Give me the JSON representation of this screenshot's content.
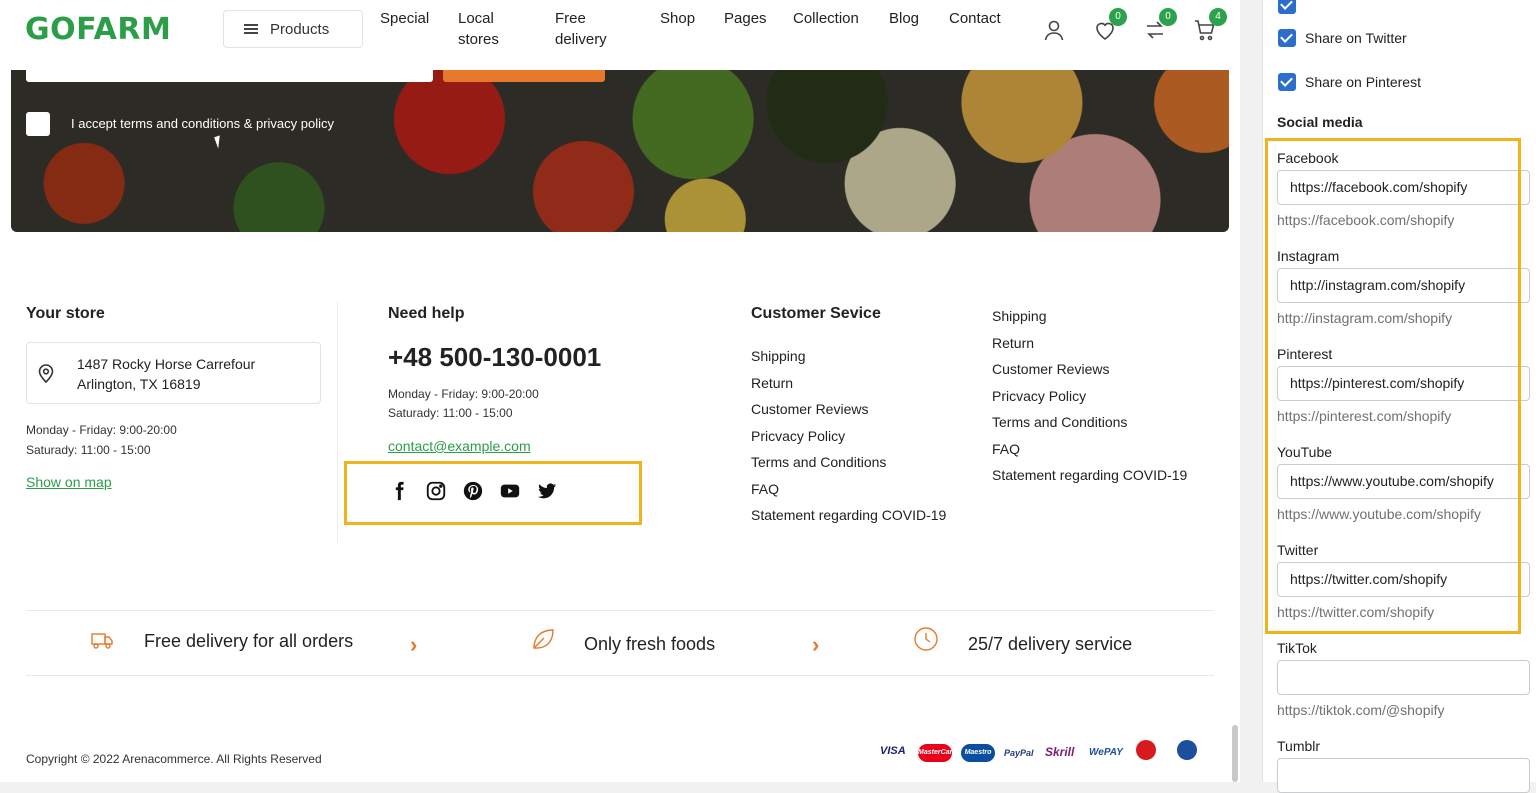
{
  "header": {
    "logo": "GOFARM",
    "products_label": "Products",
    "nav": [
      "Special",
      "Local\nstores",
      "Free\ndelivery",
      "Shop",
      "Pages",
      "Collection",
      "Blog",
      "Contact"
    ],
    "wishlist_count": "0",
    "compare_count": "0",
    "cart_count": "4"
  },
  "newsletter": {
    "terms": "I accept terms and conditions & privacy policy"
  },
  "footer": {
    "store_title": "Your store",
    "address_line1": "1487 Rocky Horse Carrefour",
    "address_line2": "Arlington, TX 16819",
    "hours1": "Monday - Friday: 9:00-20:00",
    "hours2": "Saturady: 11:00 - 15:00",
    "map_link": "Show on map",
    "help_title": "Need help",
    "phone": "+48 500-130-0001",
    "help_hours1": "Monday - Friday: 9:00-20:00",
    "help_hours2": "Saturady: 11:00 - 15:00",
    "email": "contact@example.com",
    "social_icons": [
      "facebook-icon",
      "instagram-icon",
      "pinterest-icon",
      "youtube-icon",
      "twitter-icon"
    ],
    "service_title": "Customer Sevice",
    "service_links": [
      "Shipping",
      "Return",
      "Customer Reviews",
      "Pricvacy Policy",
      "Terms and Conditions",
      "FAQ",
      "Statement regarding COVID-19"
    ],
    "extra_links": [
      "Shipping",
      "Return",
      "Customer Reviews",
      "Pricvacy Policy",
      "Terms and Conditions",
      "FAQ",
      "Statement regarding COVID-19"
    ],
    "features": [
      "Free delivery for all orders",
      "Only fresh foods",
      "25/7 delivery service"
    ],
    "copyright": "Copyright © 2022 Arenacommerce. All Rights Reserved",
    "payments": [
      "VISA",
      "MasterCard",
      "Maestro",
      "PayPal",
      "Skrill",
      "WePAY",
      "MoneyBooker",
      "BluePay"
    ]
  },
  "panel": {
    "share_twitter": "Share on Twitter",
    "share_pinterest": "Share on Pinterest",
    "social_heading": "Social media",
    "fields": [
      {
        "label": "Facebook",
        "value": "https://facebook.com/shopify",
        "hint": "https://facebook.com/shopify"
      },
      {
        "label": "Instagram",
        "value": "http://instagram.com/shopify",
        "hint": "http://instagram.com/shopify"
      },
      {
        "label": "Pinterest",
        "value": "https://pinterest.com/shopify",
        "hint": "https://pinterest.com/shopify"
      },
      {
        "label": "YouTube",
        "value": "https://www.youtube.com/shopify",
        "hint": "https://www.youtube.com/shopify"
      },
      {
        "label": "Twitter",
        "value": "https://twitter.com/shopify",
        "hint": "https://twitter.com/shopify"
      },
      {
        "label": "TikTok",
        "value": "",
        "hint": "https://tiktok.com/@shopify"
      },
      {
        "label": "Tumblr",
        "value": "",
        "hint": ""
      }
    ]
  },
  "colors": {
    "brand_green": "#2c9e48",
    "accent_orange": "#e8792c",
    "highlight": "#efb41b",
    "checkbox_blue": "#2c6ecb"
  }
}
